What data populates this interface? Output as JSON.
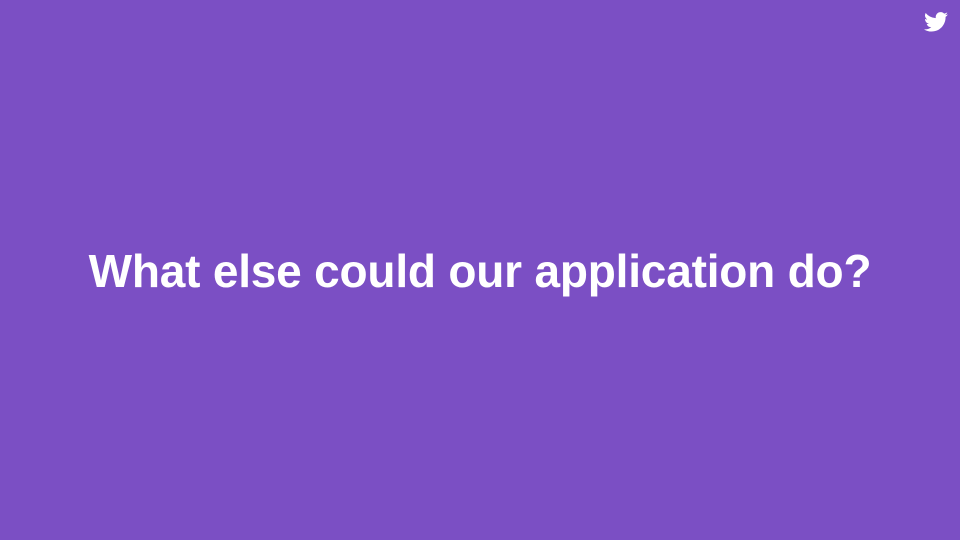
{
  "slide": {
    "title": "What else could our application do?",
    "background_color": "#7b4fc4",
    "text_color": "#ffffff",
    "corner_icon": "twitter-bird-icon"
  }
}
